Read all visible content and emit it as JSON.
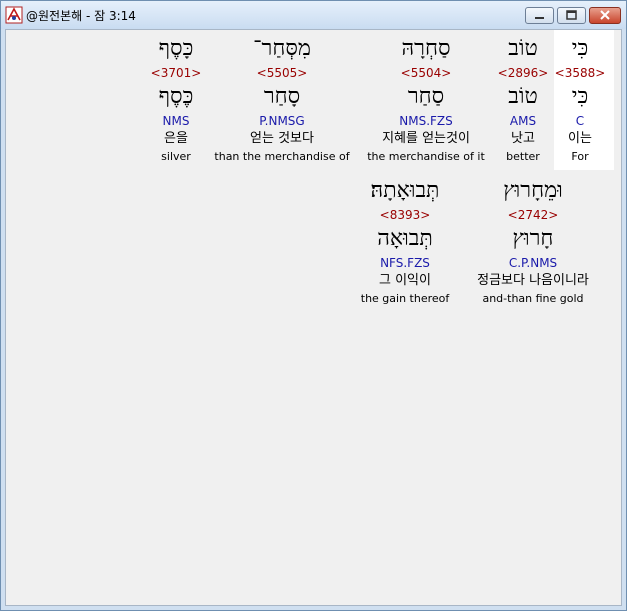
{
  "window": {
    "title": "@원전본해 - 잠 3:14"
  },
  "row1": [
    {
      "word": "כִּי",
      "strong": "<3588>",
      "lemma": "כִּי",
      "parse": "C",
      "korean": "이는",
      "english": "For"
    },
    {
      "word": "טוֹב",
      "strong": "<2896>",
      "lemma": "טוֹב",
      "parse": "AMS",
      "korean": "낫고",
      "english": "better"
    },
    {
      "word": "סַחְרָהּ",
      "strong": "<5504>",
      "lemma": "סַחַר",
      "parse": "NMS.FZS",
      "korean": "지혜를 얻는것이",
      "english": "the merchandise of it"
    },
    {
      "word": "מִסְּחַר־",
      "strong": "<5505>",
      "lemma": "סָחַר",
      "parse": "P.NMSG",
      "korean": "얻는 것보다",
      "english": "than the merchandise of"
    },
    {
      "word": "כָּסֶף",
      "strong": "<3701>",
      "lemma": "כֶּסֶף",
      "parse": "NMS",
      "korean": "은을",
      "english": "silver"
    }
  ],
  "row2": [
    {
      "word": "וּמֵחָרוּץ",
      "strong": "<2742>",
      "lemma": "חָרוּץ",
      "parse": "C.P.NMS",
      "korean": "정금보다 나음이니라",
      "english": "and-than fine gold"
    },
    {
      "word": "תְּבוּאָתָהּ׃",
      "strong": "<8393>",
      "lemma": "תְּבוּאָה",
      "parse": "NFS.FZS",
      "korean": "그 이익이",
      "english": "the gain thereof"
    }
  ]
}
